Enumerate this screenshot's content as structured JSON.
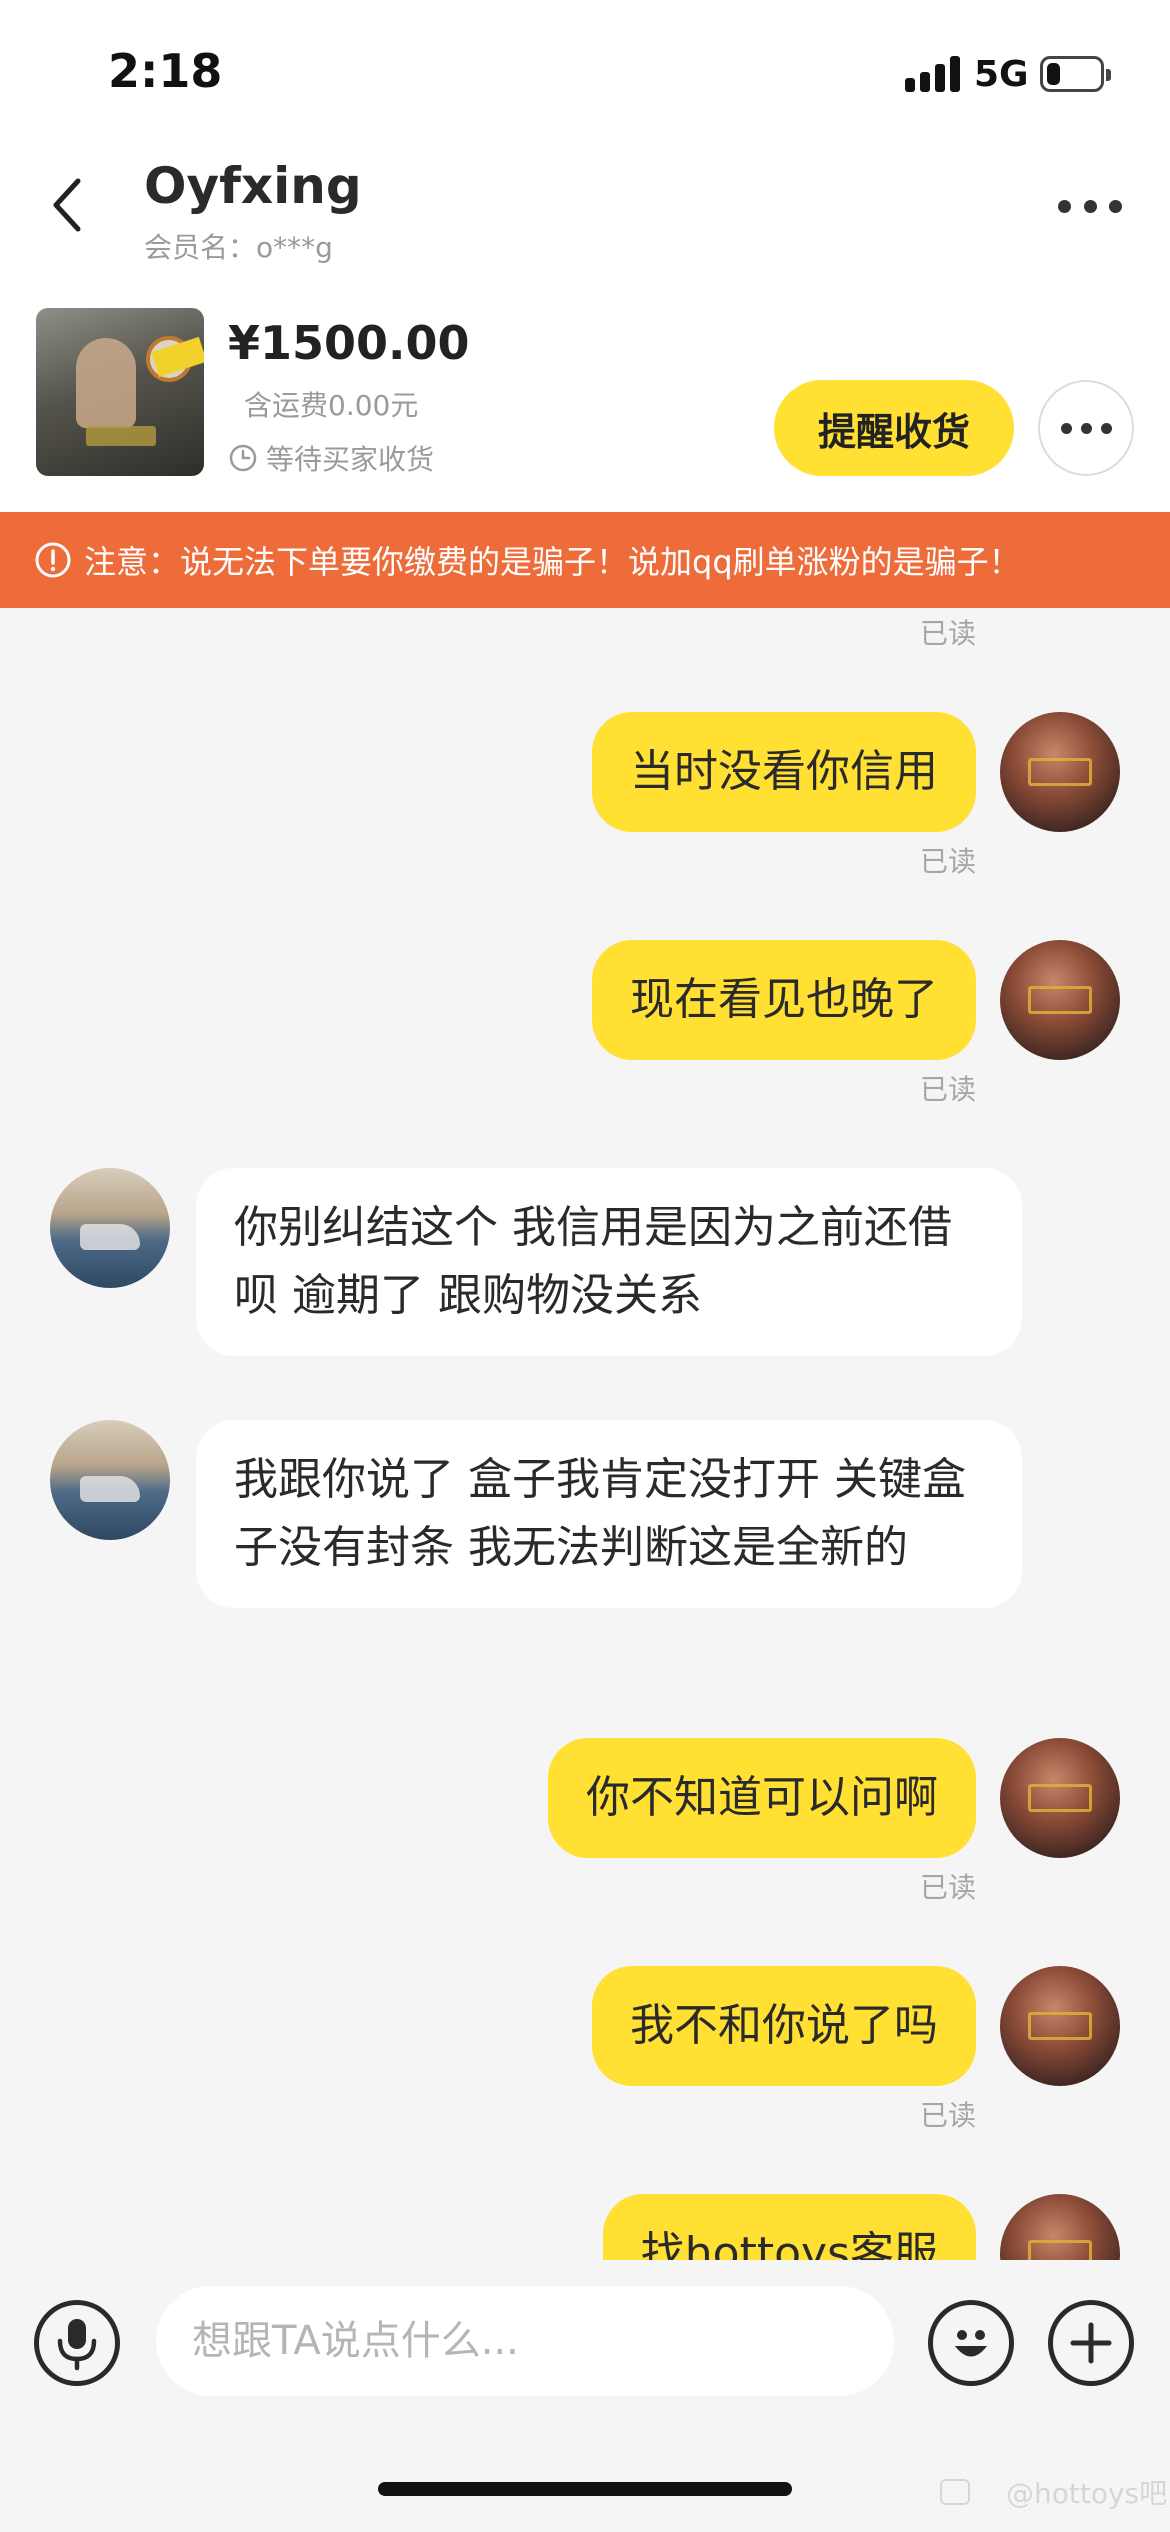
{
  "status_bar": {
    "time": "2:18",
    "network": "5G",
    "battery_level": 0.25
  },
  "header": {
    "title": "Oyfxing",
    "member_label": "会员名：o***g"
  },
  "product": {
    "price": "¥1500.00",
    "shipping": "含运费0.00元",
    "status": "等待买家收货",
    "remind_button": "提醒收货"
  },
  "warning": {
    "text": "注意：说无法下单要你缴费的是骗子！说加qq刷单涨粉的是骗子！"
  },
  "messages": [
    {
      "side": "me",
      "text": "当时没看你信用",
      "read": "已读"
    },
    {
      "side": "me",
      "text": "现在看见也晚了",
      "read": "已读"
    },
    {
      "side": "them",
      "text": "你别纠结这个   我信用是因为之前还借呗 逾期了   跟购物没关系"
    },
    {
      "side": "them",
      "text": "我跟你说了 盒子我肯定没打开    关键盒子没有封条 我无法判断这是全新的"
    },
    {
      "side": "me",
      "text": "你不知道可以问啊",
      "read": "已读"
    },
    {
      "side": "me",
      "text": "我不和你说了吗",
      "read": "已读"
    },
    {
      "side": "me",
      "text": "找hottoys客服"
    }
  ],
  "top_read_label": "已读",
  "input": {
    "placeholder": "想跟TA说点什么..."
  },
  "watermark": "@hottoys吧",
  "colors": {
    "accent_yellow": "#ffe033",
    "warning_orange": "#ee6b3a",
    "background": "#f5f5f5"
  },
  "icons": {
    "back": "chevron-left-icon",
    "more": "more-dots-icon",
    "clock": "clock-icon",
    "warning": "alert-circle-icon",
    "voice": "microphone-icon",
    "emoji": "smiley-icon",
    "plus": "plus-icon"
  }
}
